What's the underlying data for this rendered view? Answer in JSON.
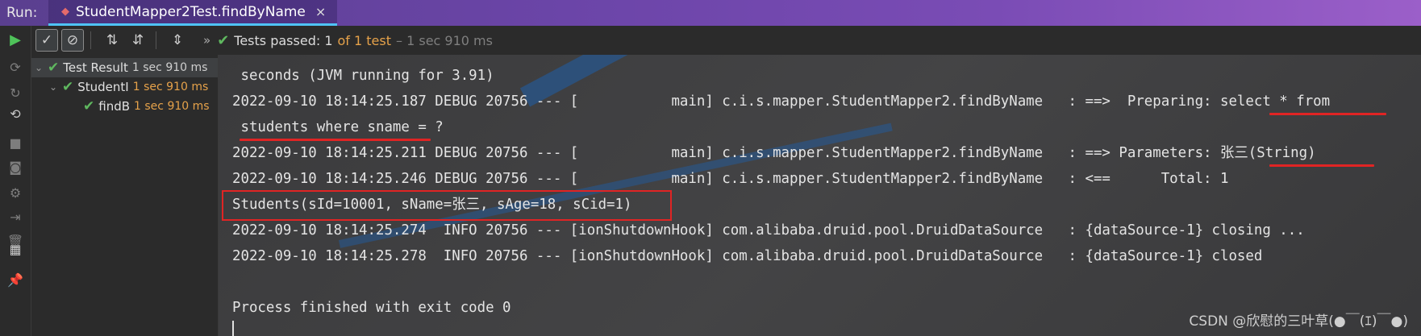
{
  "run_bar": {
    "label": "Run:",
    "tab_title": "StudentMapper2Test.findByName",
    "close_glyph": "×"
  },
  "toolbar": {
    "more_glyph": "»",
    "status_passed": "Tests passed: 1",
    "status_of": "of 1 test",
    "status_time": "– 1 sec 910 ms"
  },
  "tree": {
    "items": [
      {
        "name": "Test Result",
        "duration": "1 sec 910 ms"
      },
      {
        "name": "StudentI",
        "duration": "1 sec 910 ms"
      },
      {
        "name": "findB",
        "duration": "1 sec 910 ms"
      }
    ]
  },
  "console": {
    "lines": [
      " seconds (JVM running for 3.91)",
      "2022-09-10 18:14:25.187 DEBUG 20756 --- [           main] c.i.s.mapper.StudentMapper2.findByName   : ==>  Preparing: select * from",
      " students where sname = ?",
      "2022-09-10 18:14:25.211 DEBUG 20756 --- [           main] c.i.s.mapper.StudentMapper2.findByName   : ==> Parameters: 张三(String)",
      "2022-09-10 18:14:25.246 DEBUG 20756 --- [           main] c.i.s.mapper.StudentMapper2.findByName   : <==      Total: 1",
      "Students(sId=10001, sName=张三, sAge=18, sCid=1)",
      "2022-09-10 18:14:25.274  INFO 20756 --- [ionShutdownHook] com.alibaba.druid.pool.DruidDataSource   : {dataSource-1} closing ...",
      "2022-09-10 18:14:25.278  INFO 20756 --- [ionShutdownHook] com.alibaba.druid.pool.DruidDataSource   : {dataSource-1} closed",
      "",
      "Process finished with exit code 0"
    ]
  },
  "watermark": "CSDN @欣慰的三叶草(●￣(ｴ)￣●)",
  "colors": {
    "pass_green": "#5fb85f",
    "duration_orange": "#e6a24a",
    "highlight_red": "#e02424",
    "tab_underline": "#4fc3f7"
  },
  "icons": {
    "run": "play-icon",
    "show_passed": "check-icon",
    "show_ignored": "cancel-icon",
    "sort_alpha": "sort-alpha-icon",
    "sort_duration": "sort-duration-icon",
    "expand_all": "expand-icon",
    "test_passed": "check-icon"
  }
}
